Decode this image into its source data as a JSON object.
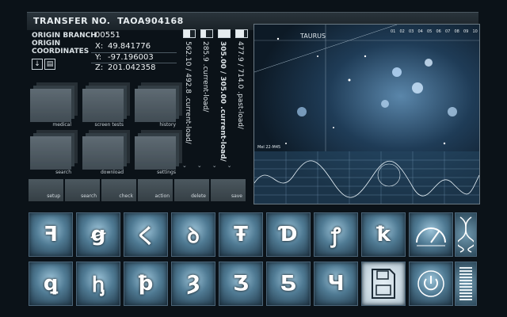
{
  "header": {
    "transfer_label": "TRANSFER NO.",
    "transfer_no": "TAOA904168"
  },
  "origin": {
    "branch_label": "ORIGIN BRANCH",
    "branch_value": "00551",
    "coords_label": "ORIGIN COORDINATES",
    "x_label": "X:",
    "x_value": "49.841776",
    "y_label": "Y:",
    "y_value": "-97.196003",
    "z_label": "Z:",
    "z_value": "201.042358"
  },
  "tiles": [
    {
      "label": "medical",
      "icon": "eye-icon"
    },
    {
      "label": "screen tests",
      "icon": "document-icon"
    },
    {
      "label": "history",
      "icon": "clock-icon"
    },
    {
      "label": "search",
      "icon": "magnifier-icon"
    },
    {
      "label": "download",
      "icon": "download-icon"
    },
    {
      "label": "settings",
      "icon": "gear-icon"
    }
  ],
  "tabs": [
    "setup",
    "search",
    "check",
    "action",
    "delete",
    "save"
  ],
  "loads": [
    {
      "text": "562.10 / 492.8 .current-load/",
      "battery": 0.6
    },
    {
      "text": "285.9 .current-load/",
      "battery": 0.4
    },
    {
      "text": "305.00 / 305.00 .current-load/",
      "battery": 1.0
    },
    {
      "text": "477.9 / 714.0 .past-load/",
      "battery": 0.7
    }
  ],
  "star_map": {
    "constellation": "TAURUS",
    "grid_numbers": [
      "01",
      "02",
      "03",
      "04",
      "05",
      "06",
      "07",
      "08",
      "09",
      "10"
    ],
    "graph_caption": "Mel 22-M45"
  },
  "keys_row1": [
    "ꟻ",
    "ꞡ",
    "く",
    "ꝺ",
    "Ŧ",
    "Ɗ",
    "ꝭ",
    "ꝁ"
  ],
  "keys_row2": [
    "ꝗ",
    "ꞕ",
    "ꝥ",
    "Ȝ",
    "Ʒ",
    "Ƽ",
    "Ч"
  ],
  "special_icons": [
    "gauge-icon",
    "dna-icon",
    "floppy-disk-icon",
    "power-icon",
    "level-bars-icon"
  ]
}
